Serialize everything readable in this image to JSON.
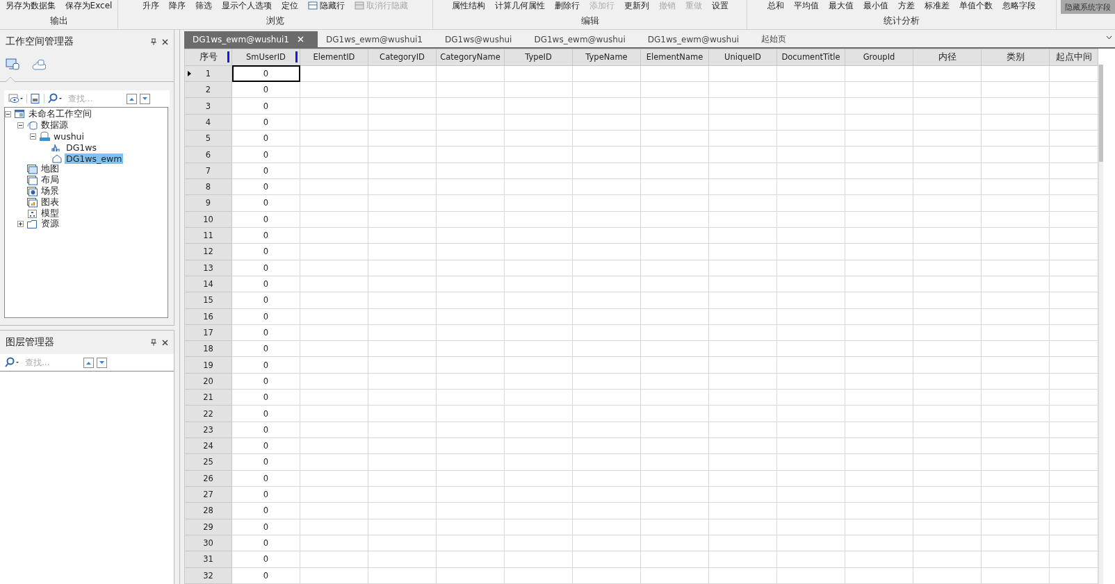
{
  "ribbon": {
    "groups": [
      {
        "label": "输出",
        "buttons": [
          {
            "label": "另存为数据集",
            "disabled": false
          },
          {
            "label": "保存为Excel",
            "disabled": false
          }
        ]
      },
      {
        "label": "浏览",
        "buttons": [
          {
            "label": "升序",
            "disabled": false
          },
          {
            "label": "降序",
            "disabled": false
          },
          {
            "label": "筛选",
            "disabled": false
          },
          {
            "label": "显示个人选项",
            "disabled": false
          },
          {
            "label": "定位",
            "disabled": false
          },
          {
            "label": "隐藏行",
            "disabled": false
          },
          {
            "label": "取消行隐藏",
            "disabled": true
          }
        ]
      },
      {
        "label": "编辑",
        "buttons": [
          {
            "label": "属性结构",
            "disabled": false
          },
          {
            "label": "计算几何属性",
            "disabled": false
          },
          {
            "label": "删除行",
            "disabled": false
          },
          {
            "label": "添加行",
            "disabled": true
          },
          {
            "label": "更新列",
            "disabled": false
          },
          {
            "label": "撤销",
            "disabled": true
          },
          {
            "label": "重做",
            "disabled": true
          },
          {
            "label": "设置",
            "disabled": false
          }
        ]
      },
      {
        "label": "统计分析",
        "buttons": [
          {
            "label": "总和",
            "disabled": false
          },
          {
            "label": "平均值",
            "disabled": false
          },
          {
            "label": "最大值",
            "disabled": false
          },
          {
            "label": "最小值",
            "disabled": false
          },
          {
            "label": "方差",
            "disabled": false
          },
          {
            "label": "标准差",
            "disabled": false
          },
          {
            "label": "单值个数",
            "disabled": false
          },
          {
            "label": "忽略字段",
            "disabled": false
          }
        ]
      }
    ],
    "side_button": "隐藏系统字段"
  },
  "workspace_panel": {
    "title": "工作空间管理器",
    "view_tabs": [
      {
        "kind": "local",
        "selected": true
      },
      {
        "kind": "cloud",
        "selected": false
      }
    ],
    "search": {
      "placeholder": "查找..."
    },
    "tree": [
      {
        "label": "未命名工作空间",
        "kind": "workspace",
        "expanded": true,
        "selected": false,
        "children": [
          {
            "label": "数据源",
            "kind": "datasources",
            "expanded": true,
            "selected": false,
            "children": [
              {
                "label": "wushui",
                "kind": "udx",
                "expanded": true,
                "selected": false,
                "children": [
                  {
                    "label": "DG1ws",
                    "kind": "network",
                    "selected": false
                  },
                  {
                    "label": "DG1ws_ewm",
                    "kind": "region",
                    "selected": true
                  }
                ]
              }
            ]
          },
          {
            "label": "地图",
            "kind": "map",
            "selected": false
          },
          {
            "label": "布局",
            "kind": "layout",
            "selected": false
          },
          {
            "label": "场景",
            "kind": "scene",
            "selected": false
          },
          {
            "label": "图表",
            "kind": "chart",
            "selected": false
          },
          {
            "label": "模型",
            "kind": "model",
            "selected": false
          },
          {
            "label": "资源",
            "kind": "folder",
            "expanded": false,
            "selected": false
          }
        ]
      }
    ]
  },
  "layer_panel": {
    "title": "图层管理器",
    "search": {
      "placeholder": "查找..."
    }
  },
  "doc_tabs": [
    {
      "label": "DG1ws_ewm@wushui1",
      "selected": true
    },
    {
      "label": "DG1ws_ewm@wushui1",
      "selected": false
    },
    {
      "label": "DG1ws@wushui",
      "selected": false
    },
    {
      "label": "DG1ws_ewm@wushui",
      "selected": false
    },
    {
      "label": "DG1ws_ewm@wushui",
      "selected": false
    },
    {
      "label": "起始页",
      "selected": false
    }
  ],
  "table": {
    "columns": [
      {
        "label": "序号",
        "marked": true
      },
      {
        "label": "SmUserID",
        "marked": true
      },
      {
        "label": "ElementID",
        "marked": false
      },
      {
        "label": "CategoryID",
        "marked": false
      },
      {
        "label": "CategoryName",
        "marked": false
      },
      {
        "label": "TypeID",
        "marked": false
      },
      {
        "label": "TypeName",
        "marked": false
      },
      {
        "label": "ElementName",
        "marked": false
      },
      {
        "label": "UniqueID",
        "marked": false
      },
      {
        "label": "DocumentTitle",
        "marked": false
      },
      {
        "label": "GroupId",
        "marked": false
      },
      {
        "label": "内径",
        "marked": false
      },
      {
        "label": "类别",
        "marked": false
      },
      {
        "label": "起点中间",
        "marked": false
      }
    ],
    "rows": [
      {
        "number": "1",
        "sm_user_id": "0",
        "current": true
      },
      {
        "number": "2",
        "sm_user_id": "0",
        "current": false
      },
      {
        "number": "3",
        "sm_user_id": "0",
        "current": false
      },
      {
        "number": "4",
        "sm_user_id": "0",
        "current": false
      },
      {
        "number": "5",
        "sm_user_id": "0",
        "current": false
      },
      {
        "number": "6",
        "sm_user_id": "0",
        "current": false
      },
      {
        "number": "7",
        "sm_user_id": "0",
        "current": false
      },
      {
        "number": "8",
        "sm_user_id": "0",
        "current": false
      },
      {
        "number": "9",
        "sm_user_id": "0",
        "current": false
      },
      {
        "number": "10",
        "sm_user_id": "0",
        "current": false
      },
      {
        "number": "11",
        "sm_user_id": "0",
        "current": false
      },
      {
        "number": "12",
        "sm_user_id": "0",
        "current": false
      },
      {
        "number": "13",
        "sm_user_id": "0",
        "current": false
      },
      {
        "number": "14",
        "sm_user_id": "0",
        "current": false
      },
      {
        "number": "15",
        "sm_user_id": "0",
        "current": false
      },
      {
        "number": "16",
        "sm_user_id": "0",
        "current": false
      },
      {
        "number": "17",
        "sm_user_id": "0",
        "current": false
      },
      {
        "number": "18",
        "sm_user_id": "0",
        "current": false
      },
      {
        "number": "19",
        "sm_user_id": "0",
        "current": false
      },
      {
        "number": "20",
        "sm_user_id": "0",
        "current": false
      },
      {
        "number": "21",
        "sm_user_id": "0",
        "current": false
      },
      {
        "number": "22",
        "sm_user_id": "0",
        "current": false
      },
      {
        "number": "23",
        "sm_user_id": "0",
        "current": false
      },
      {
        "number": "24",
        "sm_user_id": "0",
        "current": false
      },
      {
        "number": "25",
        "sm_user_id": "0",
        "current": false
      },
      {
        "number": "26",
        "sm_user_id": "0",
        "current": false
      },
      {
        "number": "27",
        "sm_user_id": "0",
        "current": false
      },
      {
        "number": "28",
        "sm_user_id": "0",
        "current": false
      },
      {
        "number": "29",
        "sm_user_id": "0",
        "current": false
      },
      {
        "number": "30",
        "sm_user_id": "0",
        "current": false
      },
      {
        "number": "31",
        "sm_user_id": "0",
        "current": false
      },
      {
        "number": "32",
        "sm_user_id": "0",
        "current": false
      }
    ]
  }
}
